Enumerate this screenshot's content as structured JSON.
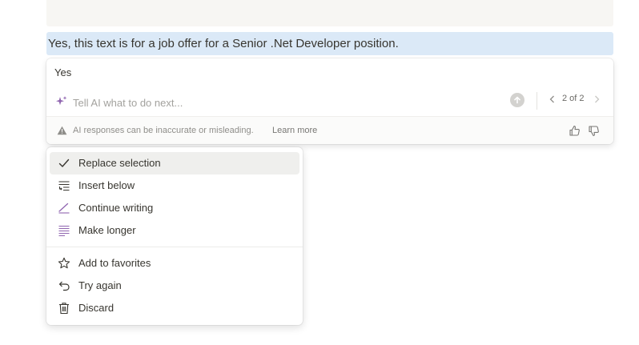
{
  "document": {
    "selected_text": "Yes, this text is for a job offer for a Senior .Net Developer position."
  },
  "ai_panel": {
    "response": "Yes",
    "prompt_placeholder": "Tell AI what to do next...",
    "pager": "2 of 2",
    "disclaimer": "AI responses can be inaccurate or misleading.",
    "learn_more": "Learn more"
  },
  "menu": {
    "items": [
      {
        "label": "Replace selection",
        "icon": "checkmark-icon",
        "active": true
      },
      {
        "label": "Insert below",
        "icon": "insert-below-icon"
      },
      {
        "label": "Continue writing",
        "icon": "pen-icon"
      },
      {
        "label": "Make longer",
        "icon": "lines-icon"
      }
    ],
    "secondary_items": [
      {
        "label": "Add to favorites",
        "icon": "star-icon"
      },
      {
        "label": "Try again",
        "icon": "undo-icon"
      },
      {
        "label": "Discard",
        "icon": "trash-icon"
      }
    ]
  },
  "colors": {
    "selection": "#dbe9f7",
    "ai_accent": "#9065b0",
    "hover": "#efefed"
  }
}
